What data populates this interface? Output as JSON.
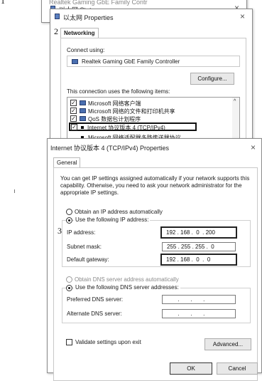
{
  "back_status": {
    "title_partial": "Realtek Gaming GbE Family Contr",
    "title": "以太网 Status"
  },
  "properties": {
    "title": "以太网 Properties",
    "tab": "Networking",
    "connect_using_label": "Connect using:",
    "adapter": "Realtek Gaming GbE Family Controller",
    "configure_button": "Configure...",
    "items_label": "This connection uses the following items:",
    "items": [
      {
        "label": "Microsoft 网络客户端",
        "checked": true
      },
      {
        "label": "Microsoft 网络的文件和打印机共享",
        "checked": true
      },
      {
        "label": "QoS 数据包计划程序",
        "checked": true
      },
      {
        "label": "Internet 协议版本 4 (TCP/IPv4)",
        "checked": true
      },
      {
        "label": "Microsoft 网络适配器多路传送器协议",
        "checked": false
      }
    ]
  },
  "ipv4": {
    "title": "Internet 协议版本 4 (TCP/IPv4) Properties",
    "tab": "General",
    "description": "You can get IP settings assigned automatically if your network supports this capability. Otherwise, you need to ask your network administrator for the appropriate IP settings.",
    "auto_ip_label": "Obtain an IP address automatically",
    "use_ip_label": "Use the following IP address:",
    "ip_label": "IP address:",
    "ip_value": "192 . 168 .  0  . 200",
    "subnet_label": "Subnet mask:",
    "subnet_value": "255 . 255 . 255 .  0",
    "gateway_label": "Default gateway:",
    "gateway_value": "192 . 168 .  0  .  0",
    "auto_dns_label": "Obtain DNS server address automatically",
    "use_dns_label": "Use the following DNS server addresses:",
    "preferred_dns_label": "Preferred DNS server:",
    "preferred_dns_value": "       .       .       .",
    "alternate_dns_label": "Alternate DNS server:",
    "alternate_dns_value": "       .       .       .",
    "validate_label": "Validate settings upon exit",
    "advanced_button": "Advanced...",
    "ok_button": "OK",
    "cancel_button": "Cancel"
  },
  "annotations": {
    "step1": "1",
    "step2": "2",
    "step3": "3"
  }
}
